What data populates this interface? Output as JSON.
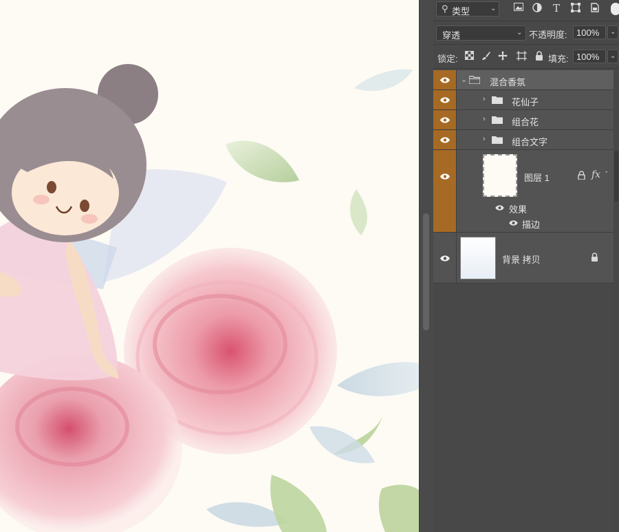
{
  "panel": {
    "filter": {
      "kind_label": "类型",
      "icons": [
        "image-filter-icon",
        "adjustment-filter-icon",
        "text-filter-icon",
        "shape-filter-icon",
        "smart-object-filter-icon"
      ]
    },
    "blend_mode": "穿透",
    "opacity_label": "不透明度:",
    "opacity_value": "100%",
    "lock_label": "锁定:",
    "fill_label": "填充:",
    "fill_value": "100%",
    "accent_color": "#a66a24"
  },
  "layers": [
    {
      "name": "混合香氛",
      "type": "group",
      "expanded": true,
      "selected": true
    },
    {
      "name": "花仙子",
      "type": "group",
      "expanded": false
    },
    {
      "name": "组合花",
      "type": "group",
      "expanded": false
    },
    {
      "name": "组合文字",
      "type": "group",
      "expanded": false
    },
    {
      "name": "图层 1",
      "type": "pixel",
      "effects_label": "效果",
      "effect_items": [
        "描边"
      ],
      "fx_label": "fx"
    },
    {
      "name": "背景 拷贝",
      "type": "pixel",
      "locked": true
    }
  ]
}
